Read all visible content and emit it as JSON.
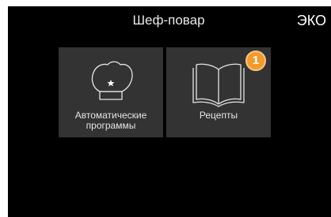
{
  "header": {
    "title": "Шеф-повар",
    "mode": "ЭКО"
  },
  "tiles": [
    {
      "label_line1": "Автоматические",
      "label_line2": "программы",
      "icon": "chef-hat-icon"
    },
    {
      "label_line1": "Рецепты",
      "icon": "open-book-icon"
    }
  ],
  "badge": {
    "value": "1",
    "color": "#f39a2b"
  },
  "colors": {
    "background": "#000000",
    "tile": "#333333",
    "text": "#e4e4e4"
  }
}
